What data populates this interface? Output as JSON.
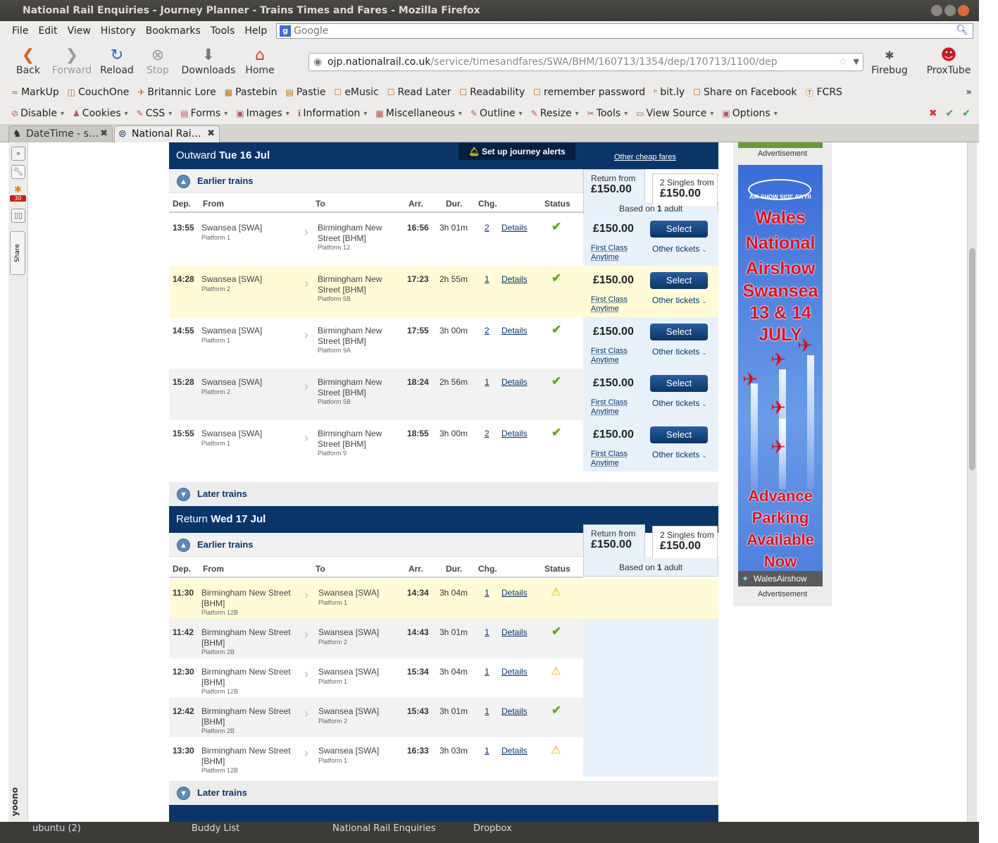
{
  "window": {
    "title": "National Rail Enquiries - Journey Planner - Trains Times and Fares - Mozilla Firefox"
  },
  "menu": [
    "File",
    "Edit",
    "View",
    "History",
    "Bookmarks",
    "Tools",
    "Help"
  ],
  "search": {
    "placeholder": "Google"
  },
  "nav": {
    "back": "Back",
    "forward": "Forward",
    "reload": "Reload",
    "stop": "Stop",
    "downloads": "Downloads",
    "home": "Home",
    "firebug": "Firebug",
    "proxtube": "ProxTube"
  },
  "url": {
    "domain": "ojp.nationalrail.co.uk",
    "path": "/service/timesandfares/SWA/BHM/160713/1354/dep/170713/1100/dep"
  },
  "bookmarks": [
    "MarkUp",
    "CouchOne",
    "Britannic Lore",
    "Pastebin",
    "Pastie",
    "eMusic",
    "Read Later",
    "Readability",
    "remember password",
    "bit.ly",
    "Share on Facebook",
    "FCRS"
  ],
  "webdev": [
    "Disable",
    "Cookies",
    "CSS",
    "Forms",
    "Images",
    "Information",
    "Miscellaneous",
    "Outline",
    "Resize",
    "Tools",
    "View Source",
    "Options"
  ],
  "tabs": [
    {
      "label": "DateTime - s…"
    },
    {
      "label": "National Rai…"
    }
  ],
  "sidebar": {
    "badge": "30",
    "share": "Share",
    "yoono": "yoono"
  },
  "outward": {
    "label": "Outward",
    "date": "Tue 16 Jul",
    "alerts": "Set up journey alerts",
    "cheap": "Other cheap fares",
    "earlier": "Earlier trains",
    "later": "Later trains",
    "return_from": "Return from",
    "return_price": "£150.00",
    "singles_from": "2 Singles from",
    "singles_price": "£150.00",
    "based_on": "Based on",
    "adults": "1",
    "adult_word": "adult",
    "rows": [
      {
        "dep": "13:55",
        "from": "Swansea [SWA]",
        "from_plat": "Platform 1",
        "to1": "Birmingham New",
        "to2": "Street [BHM]",
        "to_plat": "Platform 12",
        "arr": "16:56",
        "dur": "3h 01m",
        "chg": "2",
        "price": "£150.00",
        "fare1": "First Class",
        "fare2": "Anytime"
      },
      {
        "dep": "14:28",
        "from": "Swansea [SWA]",
        "from_plat": "Platform 2",
        "to1": "Birmingham New",
        "to2": "Street [BHM]",
        "to_plat": "Platform 5B",
        "arr": "17:23",
        "dur": "2h 55m",
        "chg": "1",
        "price": "£150.00",
        "fare1": "First Class",
        "fare2": "Anytime"
      },
      {
        "dep": "14:55",
        "from": "Swansea [SWA]",
        "from_plat": "Platform 1",
        "to1": "Birmingham New",
        "to2": "Street [BHM]",
        "to_plat": "Platform 9A",
        "arr": "17:55",
        "dur": "3h 00m",
        "chg": "2",
        "price": "£150.00",
        "fare1": "First Class",
        "fare2": "Anytime"
      },
      {
        "dep": "15:28",
        "from": "Swansea [SWA]",
        "from_plat": "Platform 2",
        "to1": "Birmingham New",
        "to2": "Street [BHM]",
        "to_plat": "Platform 5B",
        "arr": "18:24",
        "dur": "2h 56m",
        "chg": "1",
        "price": "£150.00",
        "fare1": "First Class",
        "fare2": "Anytime"
      },
      {
        "dep": "15:55",
        "from": "Swansea [SWA]",
        "from_plat": "Platform 1",
        "to1": "Birmingham New",
        "to2": "Street [BHM]",
        "to_plat": "Platform 9",
        "arr": "18:55",
        "dur": "3h 00m",
        "chg": "2",
        "price": "£150.00",
        "fare1": "First Class",
        "fare2": "Anytime"
      }
    ]
  },
  "inbound": {
    "label": "Return",
    "date": "Wed 17 Jul",
    "earlier": "Earlier trains",
    "later": "Later trains",
    "return_from": "Return from",
    "return_price": "£150.00",
    "singles_from": "2 Singles from",
    "singles_price": "£150.00",
    "based_on": "Based on",
    "adults": "1",
    "adult_word": "adult",
    "rows": [
      {
        "dep": "11:30",
        "from1": "Birmingham New Street",
        "from2": "[BHM]",
        "from_plat": "Platform 12B",
        "to": "Swansea [SWA]",
        "to_plat": "Platform 1",
        "arr": "14:34",
        "dur": "3h 04m",
        "chg": "1",
        "status": "warning"
      },
      {
        "dep": "11:42",
        "from1": "Birmingham New Street",
        "from2": "[BHM]",
        "from_plat": "Platform 2B",
        "to": "Swansea [SWA]",
        "to_plat": "Platform 2",
        "arr": "14:43",
        "dur": "3h 01m",
        "chg": "1",
        "status": "ok"
      },
      {
        "dep": "12:30",
        "from1": "Birmingham New Street",
        "from2": "[BHM]",
        "from_plat": "Platform 12B",
        "to": "Swansea [SWA]",
        "to_plat": "Platform 1",
        "arr": "15:34",
        "dur": "3h 04m",
        "chg": "1",
        "status": "warning"
      },
      {
        "dep": "12:42",
        "from1": "Birmingham New Street",
        "from2": "[BHM]",
        "from_plat": "Platform 2B",
        "to": "Swansea [SWA]",
        "to_plat": "Platform 2",
        "arr": "15:43",
        "dur": "3h 01m",
        "chg": "1",
        "status": "ok"
      },
      {
        "dep": "13:30",
        "from1": "Birmingham New Street",
        "from2": "[BHM]",
        "from_plat": "Platform 12B",
        "to": "Swansea [SWA]",
        "to_plat": "Platform 1",
        "arr": "16:33",
        "dur": "3h 03m",
        "chg": "1",
        "status": "warning"
      }
    ]
  },
  "columns": {
    "dep": "Dep.",
    "from": "From",
    "to": "To",
    "arr": "Arr.",
    "dur": "Dur.",
    "chg": "Chg.",
    "status": "Status"
  },
  "row_labels": {
    "details": "Details",
    "select": "Select",
    "other_tickets": "Other tickets"
  },
  "ad": {
    "label": "Advertisement",
    "lines": [
      "Wales",
      "National",
      "Airshow",
      "Swansea",
      "13 & 14",
      "JULY",
      "Advance",
      "Parking",
      "Available",
      "Now"
    ],
    "small": "AIR SHOW SIOE AWYR",
    "twitter": "WalesAirshow"
  },
  "taskbar": [
    "ubuntu (2)",
    "Buddy List",
    "National Rail Enquiries",
    "Dropbox"
  ],
  "colors": {
    "navy": "#0b3569",
    "tick": "#6aa71a",
    "warn": "#e6b800",
    "highlight": "#fffbd0"
  }
}
